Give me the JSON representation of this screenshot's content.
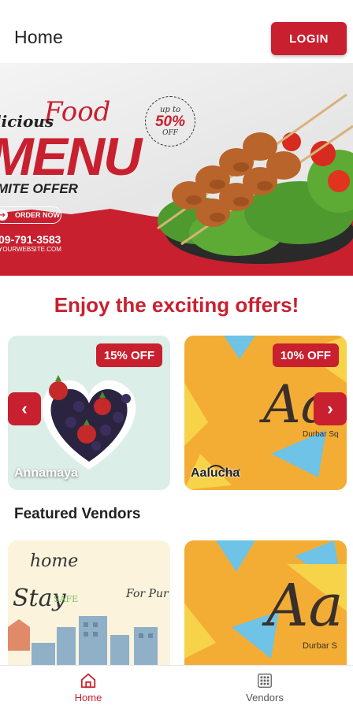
{
  "header": {
    "title": "Home",
    "login_label": "LOGIN"
  },
  "banner": {
    "script_text": "Food",
    "delicious_text": "licious",
    "menu_text": "MENU",
    "limited_text": "MITE OFFER",
    "order_label": "ORDER NOW",
    "phone": "09-791-3583",
    "website": "YOURWEBSITE.COM",
    "badge_top": "up to",
    "badge_main": "50%",
    "badge_bottom": "OFF"
  },
  "offers": {
    "title": "Enjoy the exciting offers!",
    "prev_label": "‹",
    "next_label": "›",
    "items": [
      {
        "name": "Annamaya",
        "discount": "15% OFF"
      },
      {
        "name": "Aalucha",
        "discount": "10% OFF"
      }
    ]
  },
  "featured": {
    "title": "Featured Vendors",
    "items": [
      {
        "text_line1": "home",
        "text_line2": "Stay",
        "text_line3": "SAFE",
        "text_line4": "For Pur"
      },
      {
        "text_line1": "Aa",
        "text_line2": "Durbar S"
      }
    ]
  },
  "bottom_nav": {
    "items": [
      {
        "label": "Home",
        "icon": "home-icon",
        "active": true
      },
      {
        "label": "Vendors",
        "icon": "grid-icon",
        "active": false
      }
    ]
  },
  "colors": {
    "accent": "#c8202f",
    "orange": "#f3ad35",
    "mint": "#dceee8"
  }
}
